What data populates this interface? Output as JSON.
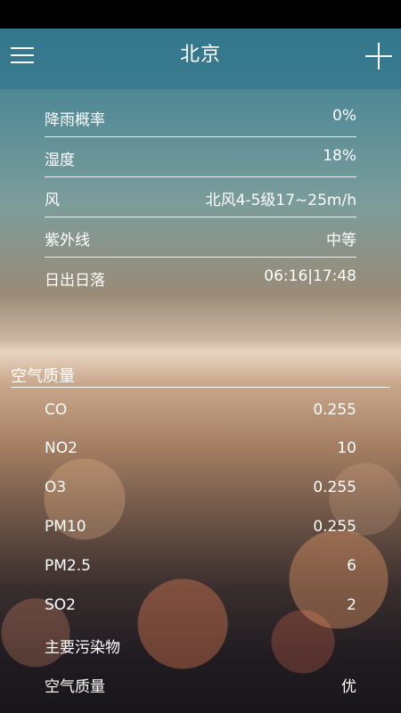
{
  "header": {
    "city": "北京"
  },
  "details": [
    {
      "label": "降雨概率",
      "value": "0%"
    },
    {
      "label": "湿度",
      "value": "18%"
    },
    {
      "label": "风",
      "value": "北风4-5级17~25m/h"
    },
    {
      "label": "紫外线",
      "value": "中等"
    },
    {
      "label": "日出日落",
      "value": "06:16|17:48"
    }
  ],
  "air_quality": {
    "title": "空气质量",
    "rows": [
      {
        "label": "CO",
        "value": "0.255"
      },
      {
        "label": "NO2",
        "value": "10"
      },
      {
        "label": "O3",
        "value": "0.255"
      },
      {
        "label": "PM10",
        "value": "0.255"
      },
      {
        "label": "PM2.5",
        "value": "6"
      },
      {
        "label": "SO2",
        "value": "2"
      },
      {
        "label": "主要污染物",
        "value": ""
      },
      {
        "label": "空气质量",
        "value": "优"
      }
    ]
  },
  "icons": {
    "menu": "menu-icon",
    "add": "plus-icon"
  }
}
